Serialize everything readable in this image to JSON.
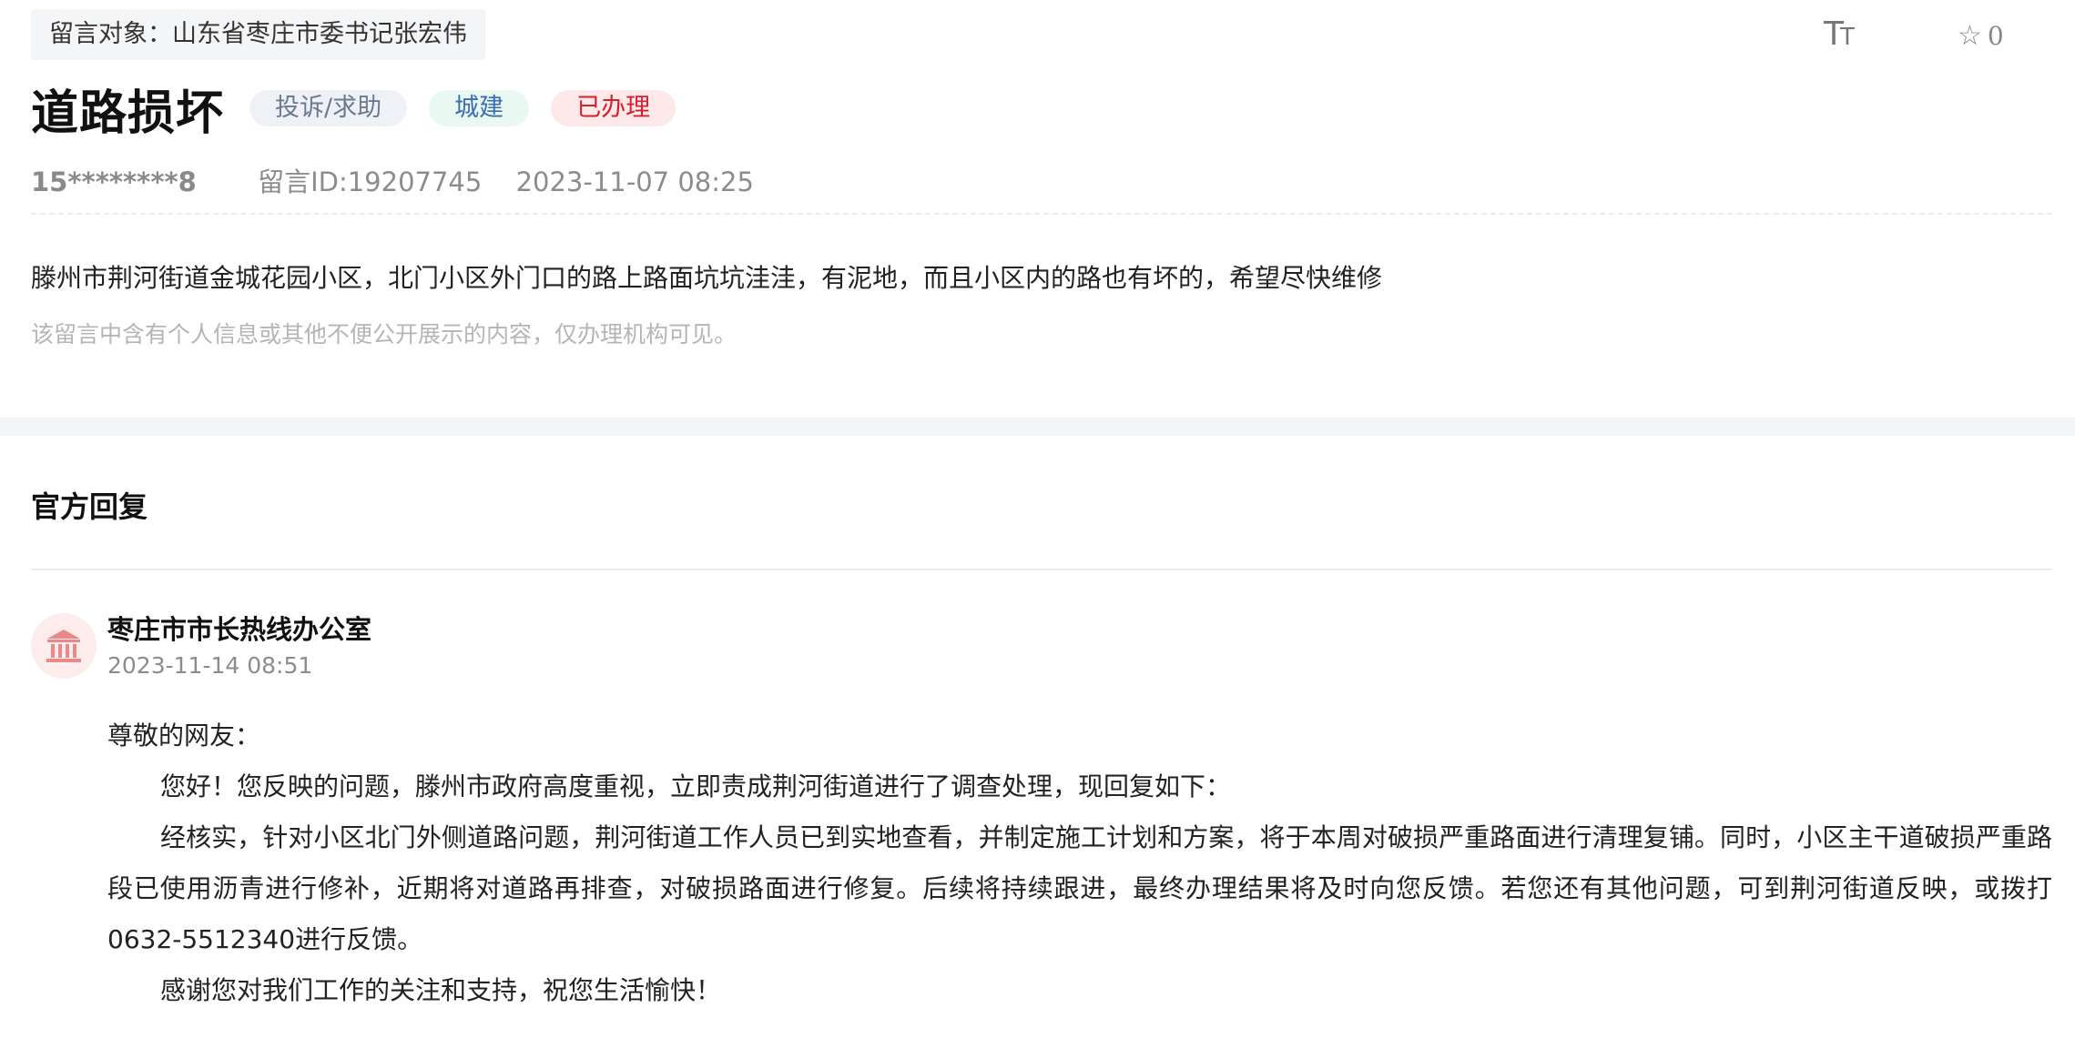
{
  "header": {
    "target_chip": "留言对象：山东省枣庄市委书记张宏伟",
    "font_toggle_big": "T",
    "font_toggle_small": "T",
    "favorite_count": "0",
    "icons": [
      "font-size-icon",
      "star-icon"
    ]
  },
  "message": {
    "title": "道路损坏",
    "tags": [
      {
        "label": "投诉/求助",
        "color": "#6c7a8f"
      },
      {
        "label": "城建",
        "color": "#3a6db5"
      },
      {
        "label": "已办理",
        "color": "#d4202d"
      }
    ],
    "user": "15********8",
    "message_id": "留言ID:19207745",
    "datetime": "2023-11-07 08:25",
    "content": "滕州市荆河街道金城花园小区，北门小区外门口的路上路面坑坑洼洼，有泥地，而且小区内的路也有坏的，希望尽快维修",
    "privacy_note": "该留言中含有个人信息或其他不便公开展示的内容，仅办理机构可见。"
  },
  "reply": {
    "heading": "官方回复",
    "office_name": "枣庄市市长热线办公室",
    "office_icon": "government-building-icon",
    "datetime": "2023-11-14 08:51",
    "greeting": "尊敬的网友：",
    "para1": "您好！您反映的问题，滕州市政府高度重视，立即责成荆河街道进行了调查处理，现回复如下：",
    "para2": "经核实，针对小区北门外侧道路问题，荆河街道工作人员已到实地查看，并制定施工计划和方案，将于本周对破损严重路面进行清理复铺。同时，小区主干道破损严重路段已使用沥青进行修补，近期将对道路再排查，对破损路面进行修复。后续将持续跟进，最终办理结果将及时向您反馈。若您还有其他问题，可到荆河街道反映，或拨打0632-5512340进行反馈。",
    "para3": "感谢您对我们工作的关注和支持，祝您生活愉快！"
  },
  "colors": {
    "accent_red": "#d4202d",
    "avatar_bg": "#fdecec",
    "section_gap": "#f4f5f8"
  }
}
